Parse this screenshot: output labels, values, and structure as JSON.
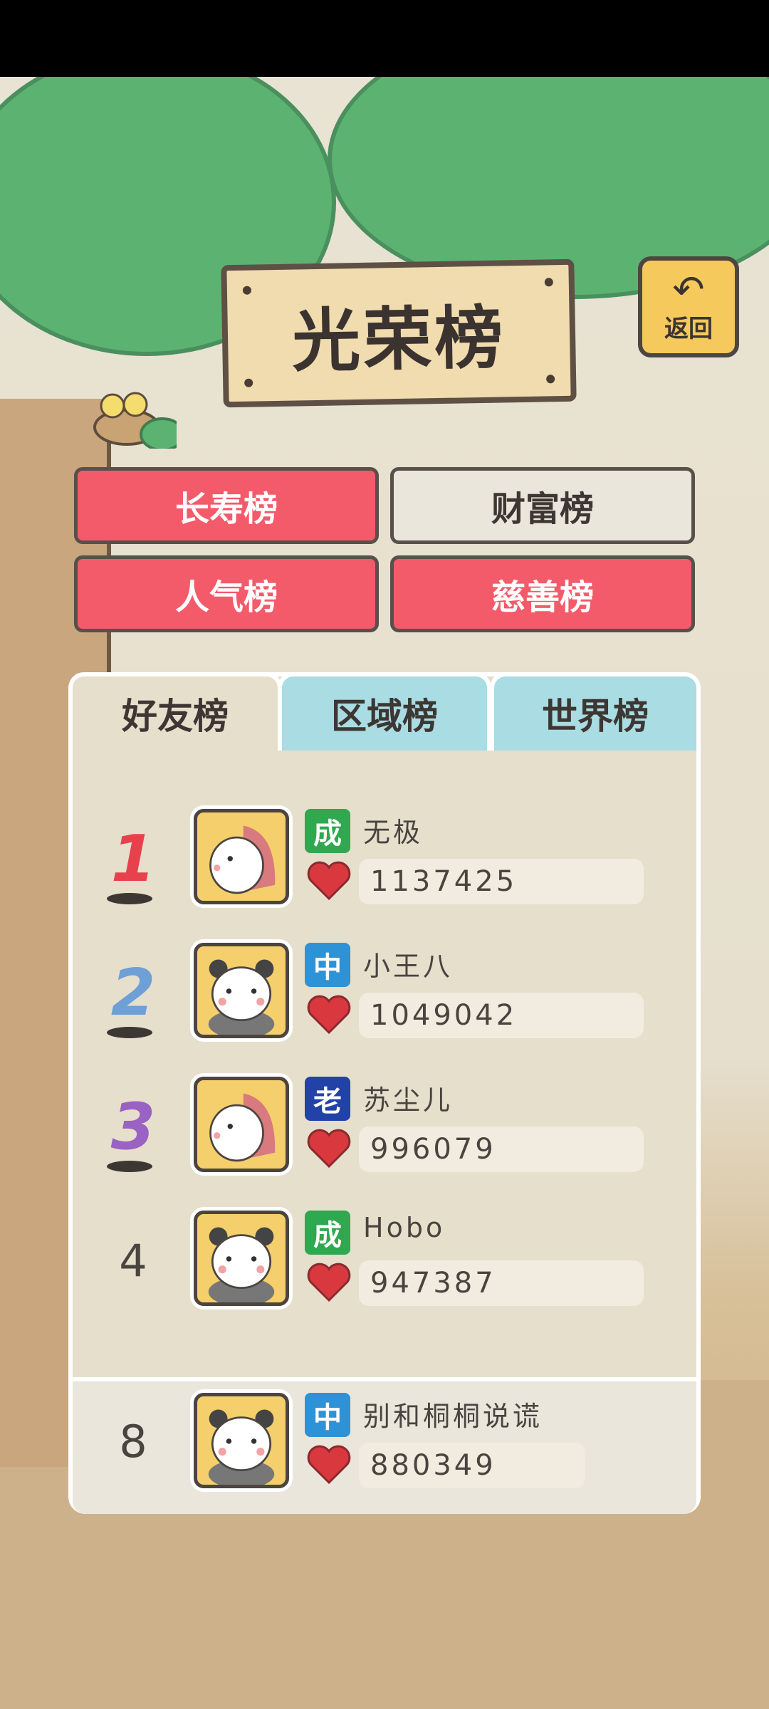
{
  "title": "光荣榜",
  "back_label": "返回",
  "categories": [
    {
      "label": "长寿榜",
      "style": "red"
    },
    {
      "label": "财富榜",
      "style": "grey"
    },
    {
      "label": "人气榜",
      "style": "red"
    },
    {
      "label": "慈善榜",
      "style": "red"
    }
  ],
  "tabs": [
    {
      "label": "好友榜",
      "active": true
    },
    {
      "label": "区域榜",
      "active": false
    },
    {
      "label": "世界榜",
      "active": false
    }
  ],
  "rows": [
    {
      "rank": "1",
      "badge": "成",
      "badge_color": "#2fa84f",
      "name": "无极",
      "score": "1137425",
      "animal": "hedgehog",
      "rank_color": "#e8414e"
    },
    {
      "rank": "2",
      "badge": "中",
      "badge_color": "#2d93d6",
      "name": "小王八",
      "score": "1049042",
      "animal": "panda",
      "rank_color": "#6e9fd6"
    },
    {
      "rank": "3",
      "badge": "老",
      "badge_color": "#2342a8",
      "name": "苏尘儿",
      "score": "996079",
      "animal": "hedgehog",
      "rank_color": "#9a62c2"
    },
    {
      "rank": "4",
      "badge": "成",
      "badge_color": "#2fa84f",
      "name": "Hobo",
      "score": "947387",
      "animal": "panda",
      "rank_color": "#4a4440"
    }
  ],
  "my_row": {
    "rank": "8",
    "badge": "中",
    "badge_color": "#2d93d6",
    "name": "别和桐桐说谎",
    "score": "880349",
    "animal": "panda"
  }
}
